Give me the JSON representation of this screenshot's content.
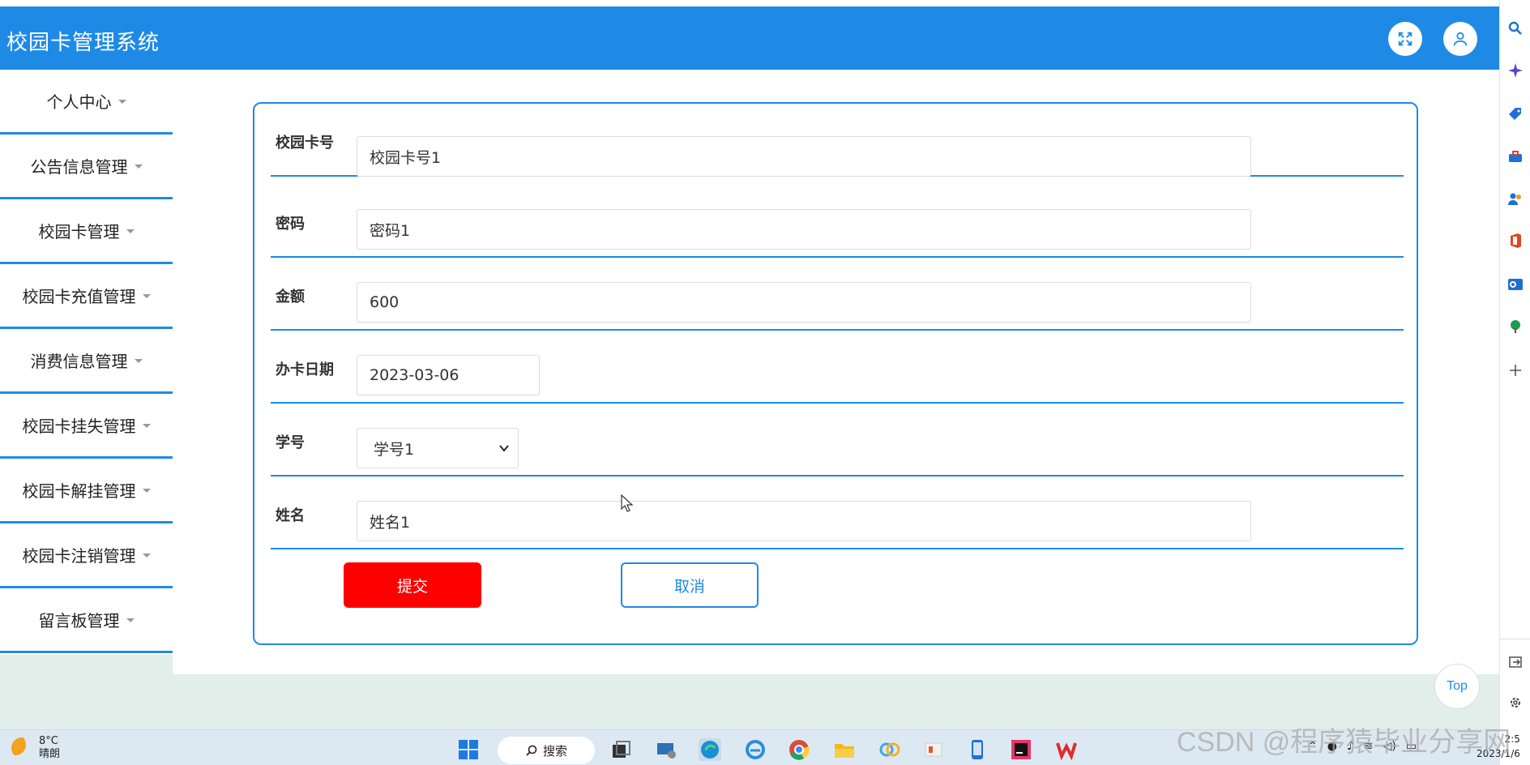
{
  "app": {
    "title": "校园卡管理系统"
  },
  "header_icons": {
    "fullscreen": "fullscreen-icon",
    "user": "user-icon"
  },
  "sidebar": {
    "items": [
      {
        "label": "个人中心"
      },
      {
        "label": "公告信息管理"
      },
      {
        "label": "校园卡管理"
      },
      {
        "label": "校园卡充值管理"
      },
      {
        "label": "消费信息管理"
      },
      {
        "label": "校园卡挂失管理"
      },
      {
        "label": "校园卡解挂管理"
      },
      {
        "label": "校园卡注销管理"
      },
      {
        "label": "留言板管理"
      }
    ]
  },
  "form": {
    "card_no": {
      "label": "校园卡号",
      "value": "校园卡号1"
    },
    "password": {
      "label": "密码",
      "value": "密码1"
    },
    "amount": {
      "label": "金额",
      "value": "600"
    },
    "issue_date": {
      "label": "办卡日期",
      "value": "2023-03-06"
    },
    "student_no": {
      "label": "学号",
      "value": "学号1"
    },
    "name": {
      "label": "姓名",
      "value": "姓名1"
    },
    "submit_label": "提交",
    "cancel_label": "取消"
  },
  "top_button": "Top",
  "taskbar": {
    "weather_temp": "8°C",
    "weather_desc": "晴朗",
    "search_label": "搜索",
    "time": "2:5",
    "date": "2023/1/6"
  },
  "watermark": "CSDN @程序猿毕业分享网",
  "colors": {
    "primary": "#1f8ae6",
    "submit": "#ff0000",
    "bottom_bg": "#e2eee9"
  }
}
